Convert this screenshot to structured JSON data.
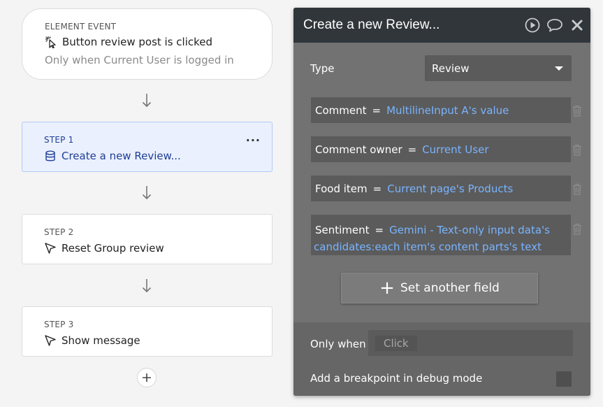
{
  "workflow": {
    "event": {
      "caption": "ELEMENT EVENT",
      "title": "Button review post is clicked",
      "condition": "Only when Current User is logged in"
    },
    "steps": [
      {
        "caption": "STEP 1",
        "title": "Create a new Review...",
        "icon": "database-icon",
        "more": "..."
      },
      {
        "caption": "STEP 2",
        "title": "Reset Group review",
        "icon": "cursor-icon"
      },
      {
        "caption": "STEP 3",
        "title": "Show message",
        "icon": "cursor-icon"
      }
    ],
    "add_step": "+"
  },
  "panel": {
    "title": "Create a new Review...",
    "header_icons": [
      "play-icon",
      "comment-icon",
      "close-icon"
    ],
    "type_label": "Type",
    "type_value": "Review",
    "fields": [
      {
        "name": "Comment",
        "eq": "=",
        "expr": "MultilineInput A's value"
      },
      {
        "name": "Comment owner",
        "eq": "=",
        "expr": "Current User"
      },
      {
        "name": "Food item",
        "eq": "=",
        "expr": "Current page's Products"
      },
      {
        "name": "Sentiment",
        "eq": "=",
        "expr_line1": "Gemini - Text-only input data's",
        "expr_line2": "candidates:each item's content parts's text"
      }
    ],
    "set_another_field": "Set another field",
    "only_when_label": "Only when",
    "only_when_placeholder": "Click",
    "breakpoint_label": "Add a breakpoint in debug mode",
    "breakpoint_checked": false
  },
  "colors": {
    "panel_bg": "#727272",
    "panel_header": "#30363a",
    "expression_blue": "#79b4ff",
    "active_step_bg": "#eaf0fd",
    "active_step_text": "#1f3f97"
  }
}
